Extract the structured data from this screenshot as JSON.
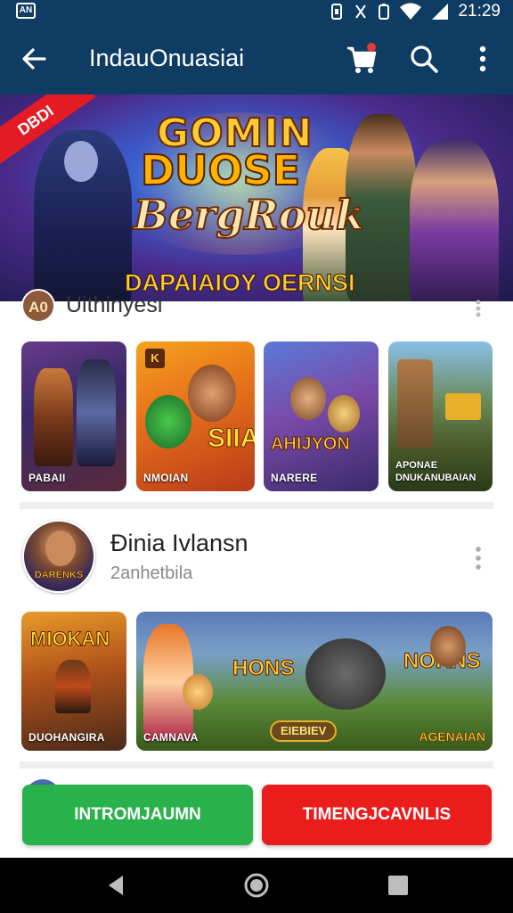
{
  "status_bar": {
    "left_icon": "app-notification-icon",
    "left_text": "AN",
    "icons": [
      "sync-icon",
      "vibrate-icon",
      "wifi-icon",
      "signal-icon"
    ],
    "time": "21:29"
  },
  "app_bar": {
    "title": "IndauOnuasiai",
    "back_icon": "arrow-left-icon",
    "cart_icon": "cart-icon",
    "search_icon": "search-icon",
    "more_icon": "more-vert-icon"
  },
  "hero": {
    "ribbon": "DBDI",
    "title_line1": "GOMIN",
    "title_line2": "DUOSE",
    "title_line3": "BergRouk",
    "subtitle": "DAPAIAIOY OERNSI"
  },
  "section1": {
    "avatar_text": "A0",
    "title": "Uithinyesi",
    "tiles": [
      {
        "label": "PABAII"
      },
      {
        "label": "NMOIAN",
        "badge": "K"
      },
      {
        "label": "NARERE",
        "art_text": "AHIJYON"
      },
      {
        "label": "APONAE DNUKANUBAIAN"
      }
    ]
  },
  "section2": {
    "avatar_text": "DARENKS",
    "name": "Đinia Ivlansn",
    "subtitle": "2anhetbila",
    "tiles": [
      {
        "title": "MIOKAN",
        "label": "DUOHANGIRA"
      },
      {
        "title": "HONS",
        "label": "CAMNAVA",
        "center_text": "EIEBIEV",
        "right_title": "NOKNS",
        "right_label": "AGENAIAN"
      }
    ]
  },
  "buttons": {
    "primary": "INTROMJAUMN",
    "secondary": "TIMENGJCAVNLIS"
  },
  "nav": {
    "back": "nav-back-icon",
    "home": "nav-home-icon",
    "recents": "nav-recents-icon"
  },
  "colors": {
    "app_bar": "#0f3c63",
    "green_button": "#29b14b",
    "red_button": "#ea1c1c"
  }
}
